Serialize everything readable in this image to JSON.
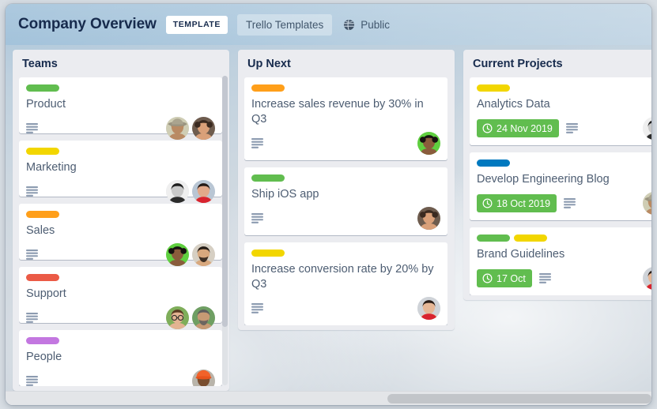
{
  "header": {
    "board_title": "Company Overview",
    "template_badge": "TEMPLATE",
    "templates_button": "Trello Templates",
    "visibility": "Public",
    "visibility_icon": "globe-icon"
  },
  "colors": {
    "green": "#61bd4f",
    "yellow": "#f2d600",
    "orange": "#ff9f1a",
    "red": "#eb5a46",
    "purple": "#c377e0",
    "blue": "#0079bf",
    "due_badge": "#61bd4f",
    "list_bg": "#ebecf0",
    "card_bg": "#ffffff",
    "title_text": "#172b4d",
    "card_text": "#4d5d72"
  },
  "lists": [
    {
      "title": "Teams",
      "has_scrollbar": true,
      "cards": [
        {
          "title": "Product",
          "labels": [
            "green"
          ],
          "due": null,
          "has_description": true,
          "avatars": [
            "man-hat",
            "woman-curly"
          ]
        },
        {
          "title": "Marketing",
          "labels": [
            "yellow"
          ],
          "due": null,
          "has_description": true,
          "avatars": [
            "woman-bw",
            "woman-dark-hair"
          ]
        },
        {
          "title": "Sales",
          "labels": [
            "orange"
          ],
          "due": null,
          "has_description": true,
          "avatars": [
            "woman-green-bg",
            "man-beard"
          ]
        },
        {
          "title": "Support",
          "labels": [
            "red"
          ],
          "due": null,
          "has_description": true,
          "avatars": [
            "woman-glasses",
            "man-gray-hair"
          ]
        },
        {
          "title": "People",
          "labels": [
            "purple"
          ],
          "due": null,
          "has_description": true,
          "avatars": [
            "man-orange-cap"
          ]
        }
      ]
    },
    {
      "title": "Up Next",
      "has_scrollbar": false,
      "cards": [
        {
          "title": "Increase sales revenue by 30% in Q3",
          "labels": [
            "orange"
          ],
          "due": null,
          "has_description": true,
          "avatars": [
            "woman-green-bg"
          ]
        },
        {
          "title": "Ship iOS app",
          "labels": [
            "green"
          ],
          "due": null,
          "has_description": true,
          "avatars": [
            "woman-curly"
          ]
        },
        {
          "title": "Increase conversion rate by 20% by Q3",
          "labels": [
            "yellow"
          ],
          "due": null,
          "has_description": true,
          "avatars": [
            "woman-red-dress"
          ]
        }
      ]
    },
    {
      "title": "Current Projects",
      "has_scrollbar": false,
      "cards": [
        {
          "title": "Analytics Data",
          "labels": [
            "yellow"
          ],
          "due": "24 Nov 2019",
          "has_description": true,
          "avatars": [
            "woman-bw"
          ]
        },
        {
          "title": "Develop Engineering Blog",
          "labels": [
            "blue"
          ],
          "due": "18 Oct 2019",
          "has_description": true,
          "avatars": [
            "man-hat"
          ]
        },
        {
          "title": "Brand Guidelines",
          "labels": [
            "green",
            "yellow"
          ],
          "due": "17 Oct",
          "has_description": true,
          "avatars": [
            "woman-red-dress"
          ]
        }
      ]
    }
  ],
  "scrollbars": {
    "horizontal_present": true,
    "list_vertical_present": true
  }
}
